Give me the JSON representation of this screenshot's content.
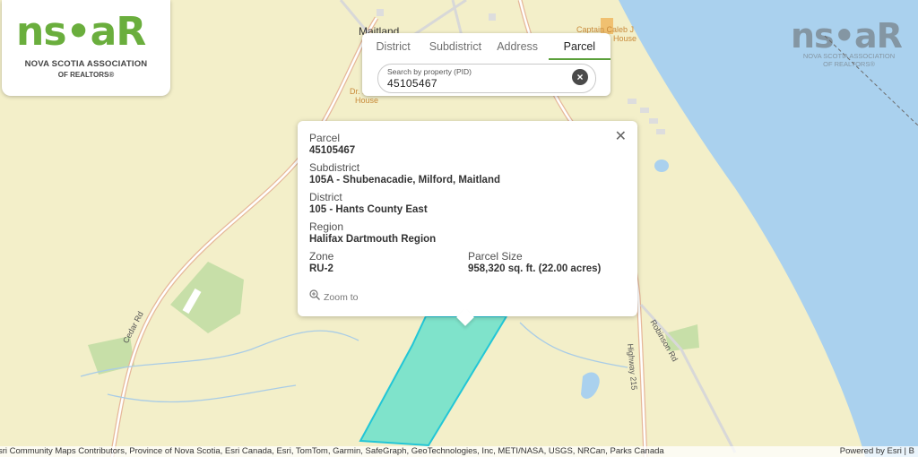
{
  "logo": {
    "word": "ns•aR",
    "line1": "NOVA SCOTIA ASSOCIATION",
    "line2": "OF REALTORS®"
  },
  "watermark": {
    "word": "ns•aR",
    "line1": "NOVA SCOTIA ASSOCIATION",
    "line2": "OF REALTORS®"
  },
  "tabs": [
    {
      "label": "District"
    },
    {
      "label": "Subdistrict"
    },
    {
      "label": "Address"
    },
    {
      "label": "Parcel"
    }
  ],
  "search": {
    "placeholder": "Search by property (PID)",
    "value": "45105467"
  },
  "popup": {
    "parcel_label": "Parcel",
    "parcel_value": "45105467",
    "subdistrict_label": "Subdistrict",
    "subdistrict_value": "105A - Shubenacadie, Milford, Maitland",
    "district_label": "District",
    "district_value": "105 - Hants County East",
    "region_label": "Region",
    "region_value": "Halifax Dartmouth Region",
    "zone_label": "Zone",
    "zone_value": "RU-2",
    "size_label": "Parcel Size",
    "size_value": "958,320 sq. ft. (22.00 acres)",
    "zoom_label": "Zoom to"
  },
  "map_labels": {
    "maitland": "Maitland",
    "captain": "Captain Caleb J",
    "captain2": "House",
    "dr": "Dr. B",
    "dr2": "House",
    "cedar": "Cedar Rd",
    "highway": "Highway 215",
    "robinson": "Robinson Rd"
  },
  "attribution": {
    "left": "sri Community Maps Contributors, Province of Nova Scotia, Esri Canada, Esri, TomTom, Garmin, SafeGraph, GeoTechnologies, Inc, METI/NASA, USGS, NRCan, Parks Canada",
    "right": "Powered by Esri | B"
  },
  "colors": {
    "land": "#f3efc9",
    "water": "#aad1ee",
    "parcel": "#7fe3cb",
    "parcel_border": "#22c6d6",
    "accent": "#5ba03b"
  }
}
